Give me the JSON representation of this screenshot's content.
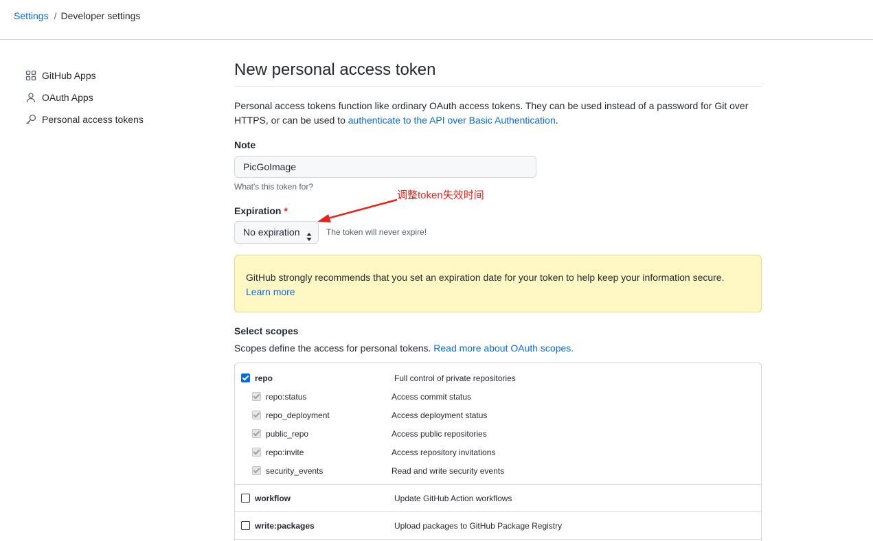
{
  "breadcrumb": {
    "root": "Settings",
    "separator": "/",
    "current": "Developer settings"
  },
  "sidebar": {
    "items": [
      {
        "label": "GitHub Apps",
        "icon": "apps-grid-icon"
      },
      {
        "label": "OAuth Apps",
        "icon": "person-icon"
      },
      {
        "label": "Personal access tokens",
        "icon": "key-icon"
      }
    ]
  },
  "main": {
    "title": "New personal access token",
    "intro_text": "Personal access tokens function like ordinary OAuth access tokens. They can be used instead of a password for Git over HTTPS, or can be used to ",
    "intro_link": "authenticate to the API over Basic Authentication",
    "intro_end": ".",
    "note": {
      "label": "Note",
      "value": "PicGoImage",
      "hint": "What's this token for?"
    },
    "expiration": {
      "label": "Expiration",
      "required_mark": "*",
      "selected": "No expiration",
      "hint": "The token will never expire!"
    },
    "warning": {
      "text": "GitHub strongly recommends that you set an expiration date for your token to help keep your information secure.",
      "link": "Learn more",
      "bg_color": "#fff8c5"
    },
    "scopes": {
      "title": "Select scopes",
      "desc": "Scopes define the access for personal tokens. ",
      "desc_link": "Read more about OAuth scopes.",
      "repo": {
        "name": "repo",
        "desc": "Full control of private repositories",
        "checked": true
      },
      "repo_children": [
        {
          "name": "repo:status",
          "desc": "Access commit status"
        },
        {
          "name": "repo_deployment",
          "desc": "Access deployment status"
        },
        {
          "name": "public_repo",
          "desc": "Access public repositories"
        },
        {
          "name": "repo:invite",
          "desc": "Access repository invitations"
        },
        {
          "name": "security_events",
          "desc": "Read and write security events"
        }
      ],
      "workflow": {
        "name": "workflow",
        "desc": "Update GitHub Action workflows",
        "checked": false
      },
      "write_packages": {
        "name": "write:packages",
        "desc": "Upload packages to GitHub Package Registry",
        "checked": false
      }
    }
  },
  "annotation": {
    "text": "调整token失效时间",
    "color": "#e8231c"
  },
  "colors": {
    "link": "#0969da",
    "accent_checkbox": "#0969da"
  }
}
